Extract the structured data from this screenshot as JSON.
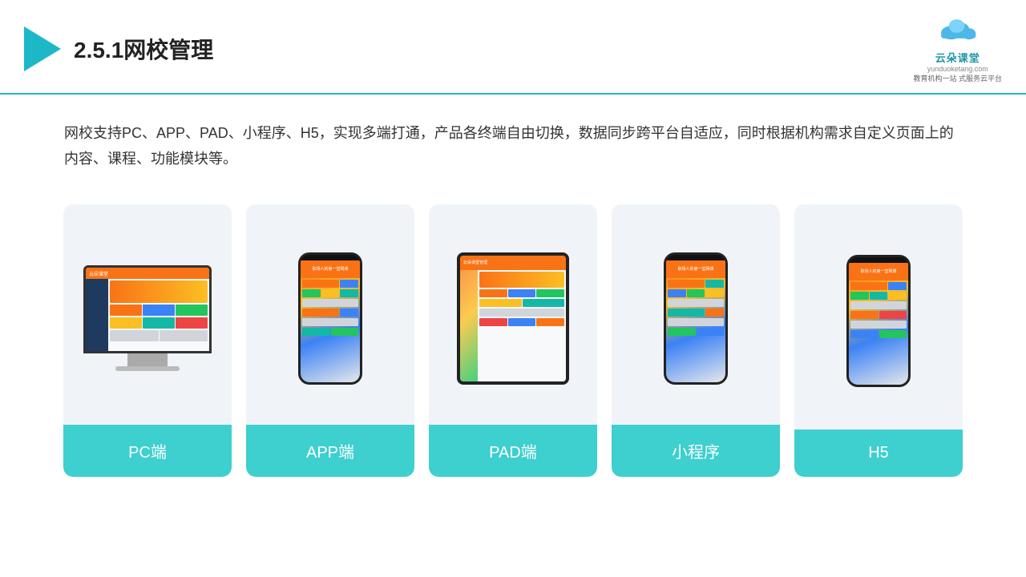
{
  "header": {
    "title": "2.5.1网校管理",
    "logo_name": "云朵课堂",
    "logo_sub": "yunduoketang.com",
    "logo_tag1": "教育机构一站",
    "logo_tag2": "式服务云平台"
  },
  "description": {
    "text": "网校支持PC、APP、PAD、小程序、H5，实现多端打通，产品各终端自由切换，数据同步跨平台自适应，同时根据机构需求自定义页面上的内容、课程、功能模块等。"
  },
  "cards": [
    {
      "id": "pc",
      "label": "PC端",
      "type": "pc"
    },
    {
      "id": "app",
      "label": "APP端",
      "type": "phone"
    },
    {
      "id": "pad",
      "label": "PAD端",
      "type": "tablet"
    },
    {
      "id": "miniapp",
      "label": "小程序",
      "type": "phone"
    },
    {
      "id": "h5",
      "label": "H5",
      "type": "phone"
    }
  ],
  "brand_color": "#3ecfcf"
}
